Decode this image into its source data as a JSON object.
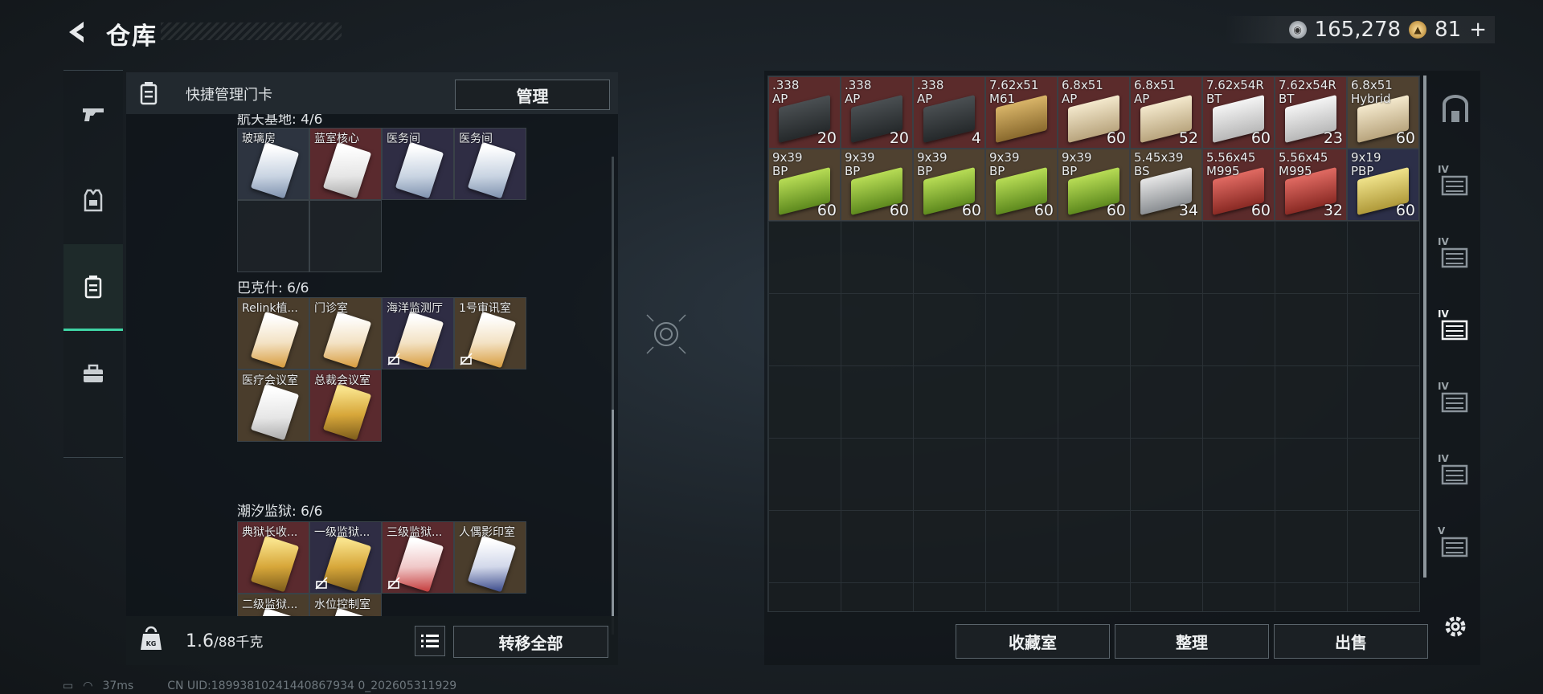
{
  "header": {
    "title": "仓库"
  },
  "currency": {
    "silver_value": "165,278",
    "gold_value": "81",
    "gold_plus": "+"
  },
  "left_tabs": [
    "weapons",
    "gear",
    "keycards",
    "supplies"
  ],
  "left_panel": {
    "header_label": "快捷管理门卡",
    "manage_label": "管理",
    "groups": [
      {
        "title": "航天基地: 4/6",
        "cards": [
          {
            "label": "玻璃房",
            "rarity": "gray",
            "color": "blue"
          },
          {
            "label": "蓝室核心",
            "rarity": "red",
            "color": "white"
          },
          {
            "label": "医务间",
            "rarity": "purple",
            "color": "blue"
          },
          {
            "label": "医务间",
            "rarity": "purple",
            "color": "blue"
          }
        ]
      },
      {
        "title": "巴克什: 6/6",
        "cards": [
          {
            "label": "Relink植...",
            "rarity": "gold",
            "color": "orange"
          },
          {
            "label": "门诊室",
            "rarity": "gold",
            "color": "orange"
          },
          {
            "label": "海洋监测厅",
            "rarity": "purple",
            "color": "orange",
            "locked": true
          },
          {
            "label": "1号审讯室",
            "rarity": "gold",
            "color": "orange",
            "locked": true
          },
          {
            "label": "医疗会议室",
            "rarity": "gold",
            "color": "white"
          },
          {
            "label": "总裁会议室",
            "rarity": "red",
            "color": "goldy"
          }
        ]
      },
      {
        "title": "潮汐监狱: 6/6",
        "cards": [
          {
            "label": "典狱长收...",
            "rarity": "red",
            "color": "goldy"
          },
          {
            "label": "一级监狱...",
            "rarity": "purple",
            "color": "goldy",
            "locked": true
          },
          {
            "label": "三级监狱...",
            "rarity": "red",
            "color": "red",
            "locked": true
          },
          {
            "label": "人偶影印室",
            "rarity": "gold",
            "color": "navy"
          },
          {
            "label": "二级监狱...",
            "rarity": "gold",
            "color": "orange",
            "locked": true
          },
          {
            "label": "水位控制室",
            "rarity": "gold",
            "color": "navy",
            "locked": true
          }
        ]
      }
    ],
    "weight_value": "1.6",
    "weight_max": "/88千克",
    "transfer_all_label": "转移全部"
  },
  "stash": {
    "items": [
      {
        "name": ".338\nAP",
        "count": "20",
        "tier": "red",
        "box": "dark"
      },
      {
        "name": ".338\nAP",
        "count": "20",
        "tier": "red",
        "box": "dark"
      },
      {
        "name": ".338\nAP",
        "count": "4",
        "tier": "red",
        "box": "dark"
      },
      {
        "name": "7.62x51\nM61",
        "count": "",
        "tier": "red",
        "box": "tan"
      },
      {
        "name": "6.8x51\nAP",
        "count": "60",
        "tier": "red",
        "box": "cream"
      },
      {
        "name": "6.8x51\nAP",
        "count": "52",
        "tier": "red",
        "box": "cream"
      },
      {
        "name": "7.62x54R\nBT",
        "count": "60",
        "tier": "red",
        "box": "white"
      },
      {
        "name": "7.62x54R\nBT",
        "count": "23",
        "tier": "red",
        "box": "white"
      },
      {
        "name": "6.8x51\nHybrid",
        "count": "60",
        "tier": "gold",
        "box": "cream"
      },
      {
        "name": "9x39\nBP",
        "count": "60",
        "tier": "gold",
        "box": "green"
      },
      {
        "name": "9x39\nBP",
        "count": "60",
        "tier": "gold",
        "box": "green"
      },
      {
        "name": "9x39\nBP",
        "count": "60",
        "tier": "gold",
        "box": "green"
      },
      {
        "name": "9x39\nBP",
        "count": "60",
        "tier": "gold",
        "box": "green"
      },
      {
        "name": "9x39\nBP",
        "count": "60",
        "tier": "gold",
        "box": "green"
      },
      {
        "name": "5.45x39\nBS",
        "count": "34",
        "tier": "gold",
        "box": "silver"
      },
      {
        "name": "5.56x45\nM995",
        "count": "60",
        "tier": "red",
        "box": "redb"
      },
      {
        "name": "5.56x45\nM995",
        "count": "32",
        "tier": "red",
        "box": "redb"
      },
      {
        "name": "9x19\nPBP",
        "count": "60",
        "tier": "navy",
        "box": "yellow"
      }
    ],
    "fav_label": "收藏室",
    "sort_label": "整理",
    "sell_label": "出售"
  },
  "right_tabs": [
    {
      "level": "",
      "active": false
    },
    {
      "level": "IV",
      "active": false
    },
    {
      "level": "IV",
      "active": false
    },
    {
      "level": "IV",
      "active": true
    },
    {
      "level": "IV",
      "active": false
    },
    {
      "level": "IV",
      "active": false
    },
    {
      "level": "V",
      "active": false
    }
  ],
  "status_bar": {
    "ping": "37ms",
    "uid": "CN UID:18993810241440867934 0_202605311929"
  },
  "colors": {
    "accent": "#3fd4a4",
    "rarity_red": "#5a2a2e",
    "rarity_gold": "#4a3d2c",
    "rarity_purple": "#2f2d44"
  }
}
